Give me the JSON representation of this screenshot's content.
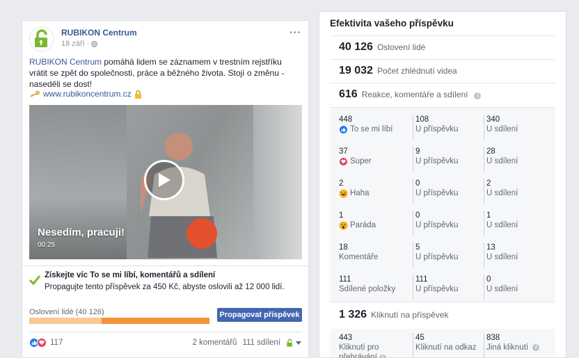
{
  "post": {
    "page_name": "RUBIKON Centrum",
    "date": "18 září",
    "more": "···",
    "text_link": "RUBIKON Centrum",
    "text_rest": " pomáhá lidem se záznamem v trestním rejstříku vrátit se zpět do společnosti, práce a běžného života. Stojí o změnu - naseděli se dost!",
    "url": "www.rubikoncentrum.cz",
    "video_title": "Nesedím, pracuji!",
    "video_time": "00:25"
  },
  "promo": {
    "title": "Získejte víc To se mi líbí, komentářů a sdílení",
    "desc": "Propagujte tento příspěvek za 450 Kč, abyste oslovili až 12 000 lidí."
  },
  "reach": {
    "label": "Oslovení lidé (40 126)",
    "organic_fraction": 0.4,
    "button": "Propagovat příspěvek"
  },
  "reactions_row": {
    "count": "117",
    "comments": "2 komentářů",
    "shares": "111 sdílení"
  },
  "stats": {
    "title": "Efektivita vašeho příspěvku",
    "reach": {
      "num": "40 126",
      "label": "Oslovení lidé"
    },
    "views": {
      "num": "19 032",
      "label": "Počet zhlédnutí videa"
    },
    "engagement": {
      "num": "616",
      "label": "Reakce, komentáře a sdílení"
    },
    "rows": [
      {
        "a": {
          "v": "448",
          "l": "To se mi líbí",
          "icon": "like"
        },
        "b": {
          "v": "108",
          "l": "U příspěvku"
        },
        "c": {
          "v": "340",
          "l": "U sdílení"
        }
      },
      {
        "a": {
          "v": "37",
          "l": "Super",
          "icon": "love"
        },
        "b": {
          "v": "9",
          "l": "U příspěvku"
        },
        "c": {
          "v": "28",
          "l": "U sdílení"
        }
      },
      {
        "a": {
          "v": "2",
          "l": "Haha",
          "icon": "haha"
        },
        "b": {
          "v": "0",
          "l": "U příspěvku"
        },
        "c": {
          "v": "2",
          "l": "U sdílení"
        }
      },
      {
        "a": {
          "v": "1",
          "l": "Paráda",
          "icon": "wow"
        },
        "b": {
          "v": "0",
          "l": "U příspěvku"
        },
        "c": {
          "v": "1",
          "l": "U sdílení"
        }
      },
      {
        "a": {
          "v": "18",
          "l": "Komentáře"
        },
        "b": {
          "v": "5",
          "l": "U příspěvku"
        },
        "c": {
          "v": "13",
          "l": "U sdílení"
        }
      },
      {
        "a": {
          "v": "111",
          "l": "Sdílené položky"
        },
        "b": {
          "v": "111",
          "l": "U příspěvku"
        },
        "c": {
          "v": "0",
          "l": "U sdílení"
        }
      }
    ],
    "clicks": {
      "num": "1 326",
      "label": "Kliknutí na příspěvek"
    },
    "click_rows": [
      {
        "v": "443",
        "l": "Kliknutí pro přehrávání"
      },
      {
        "v": "45",
        "l": "Kliknutí na odkaz"
      },
      {
        "v": "838",
        "l": "Jiná kliknutí"
      }
    ]
  },
  "colors": {
    "link": "#365899",
    "button": "#4267b2",
    "reach_paid": "#f7923a",
    "reach_organic": "#f9c98f",
    "brand_green": "#7cb82f",
    "like_blue": "#1877f2",
    "love_red": "#e4405f",
    "haha_yellow": "#f7b125"
  },
  "icons": {
    "avatar": "rubikon-lock-logo",
    "globe": "globe-icon",
    "key": "key-icon",
    "lock": "lock-icon",
    "play": "play-icon",
    "check": "check-icon",
    "info": "info-icon"
  }
}
